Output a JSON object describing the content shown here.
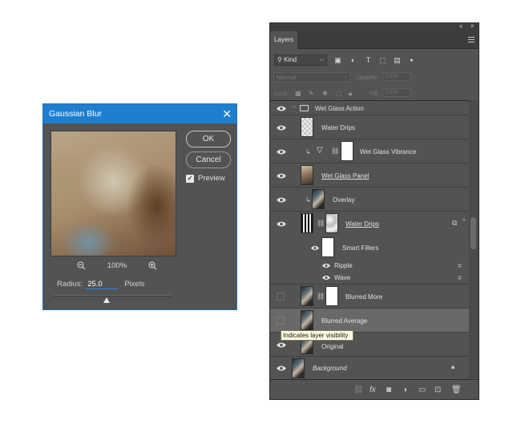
{
  "gaussian_blur": {
    "title": "Gaussian Blur",
    "ok_label": "OK",
    "cancel_label": "Cancel",
    "preview_label": "Preview",
    "preview_checked": true,
    "zoom": "100%",
    "radius_label": "Radius:",
    "radius_value": "25.0",
    "radius_unit": "Pixels"
  },
  "layers_panel": {
    "tab_label": "Layers",
    "filter_kind": "Kind",
    "blend_mode": "Normal",
    "opacity_label": "Opacity:",
    "opacity_value": "100%",
    "lock_label": "Lock:",
    "fill_label": "Fill:",
    "fill_value": "100%",
    "layers": [
      {
        "name": "Wet Glass Action",
        "type": "group",
        "visible": true
      },
      {
        "name": "Water Drips",
        "type": "layer",
        "visible": true
      },
      {
        "name": "Wet Glass Vibrance",
        "type": "adjustment",
        "visible": true
      },
      {
        "name": "Wet Glass Panel",
        "type": "layer",
        "visible": true
      },
      {
        "name": "Overlay",
        "type": "layer",
        "visible": true
      },
      {
        "name": "Water Drips",
        "type": "smart-object",
        "visible": true
      },
      {
        "name": "Smart Filters",
        "type": "smart-filters",
        "visible": true
      },
      {
        "name": "Ripple",
        "type": "filter",
        "visible": true
      },
      {
        "name": "Wave",
        "type": "filter",
        "visible": true
      },
      {
        "name": "Blurred More",
        "type": "layer",
        "visible": false
      },
      {
        "name": "Blurred Average",
        "type": "layer",
        "visible": false,
        "selected": true
      },
      {
        "name": "Original",
        "type": "layer",
        "visible": true
      },
      {
        "name": "Background",
        "type": "background",
        "visible": true
      }
    ],
    "tooltip": "Indicates layer visibility"
  },
  "colors": {
    "accent": "#1e7fd1",
    "panel_bg": "#535353",
    "selected_row": "#696969",
    "tooltip_bg": "#fffde1"
  }
}
